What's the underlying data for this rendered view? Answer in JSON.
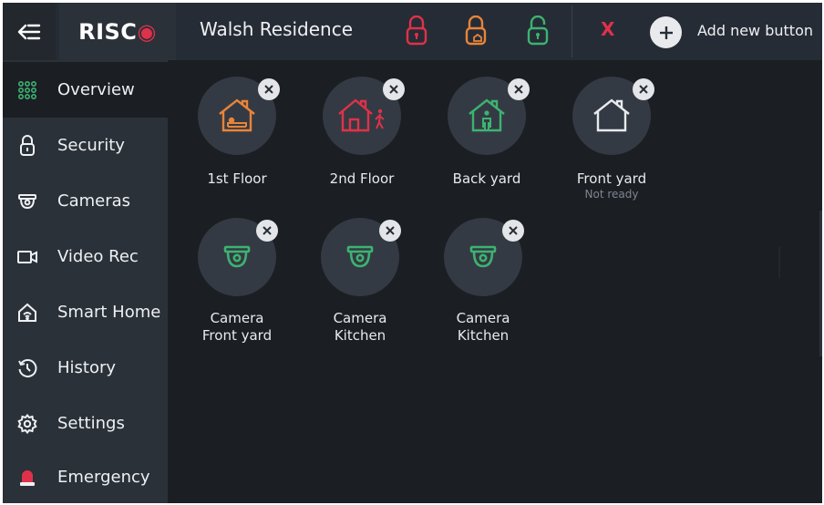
{
  "header": {
    "brand": "RISCO",
    "site_title": "Walsh Residence",
    "cancel_label": "X",
    "add_label": "Add new button",
    "lock_colors": [
      "#e0314a",
      "#e8843a",
      "#3cb371"
    ]
  },
  "sidebar": {
    "items": [
      {
        "label": "Overview",
        "icon": "grid-icon",
        "active": true
      },
      {
        "label": "Security",
        "icon": "lock-icon"
      },
      {
        "label": "Cameras",
        "icon": "camera-icon"
      },
      {
        "label": "Video Rec",
        "icon": "video-icon"
      },
      {
        "label": "Smart Home",
        "icon": "smart-home-icon"
      },
      {
        "label": "History",
        "icon": "history-icon"
      },
      {
        "label": "Settings",
        "icon": "gear-icon"
      },
      {
        "label": "Emergency",
        "icon": "siren-icon"
      }
    ]
  },
  "tiles": [
    {
      "name": "1st Floor",
      "icon": "house-sleep-icon",
      "color": "#e8843a"
    },
    {
      "name": "2nd Floor",
      "icon": "house-walk-icon",
      "color": "#e0314a"
    },
    {
      "name": "Back yard",
      "icon": "house-person-icon",
      "color": "#3cb371"
    },
    {
      "name": "Front yard",
      "sub": "Not ready",
      "icon": "house-icon",
      "color": "#e8eaed"
    },
    {
      "name1": "Camera",
      "name2": "Front yard",
      "icon": "camera-icon",
      "color": "#3cb371"
    },
    {
      "name1": "Camera",
      "name2": "Kitchen",
      "icon": "camera-icon",
      "color": "#3cb371"
    },
    {
      "name1": "Camera",
      "name2": "Kitchen",
      "icon": "camera-icon",
      "color": "#3cb371"
    }
  ]
}
